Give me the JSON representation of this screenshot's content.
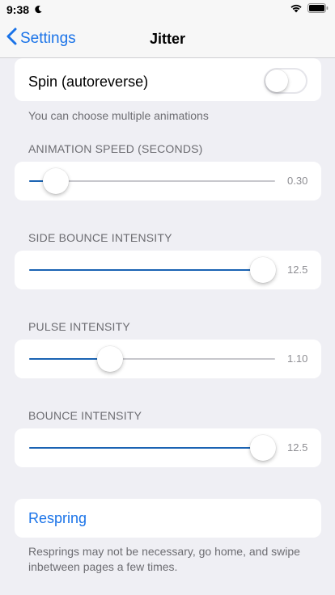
{
  "status": {
    "time": "9:38"
  },
  "nav": {
    "back_label": "Settings",
    "title": "Jitter"
  },
  "spin": {
    "label": "Spin (autoreverse)",
    "enabled": false,
    "footer": "You can choose multiple animations"
  },
  "sliders": [
    {
      "header": "ANIMATION SPEED (SECONDS)",
      "value_text": "0.30",
      "level": 0.11
    },
    {
      "header": "SIDE BOUNCE INTENSITY",
      "value_text": "12.5",
      "level": 0.95
    },
    {
      "header": "PULSE INTENSITY",
      "value_text": "1.10",
      "level": 0.33
    },
    {
      "header": "BOUNCE INTENSITY",
      "value_text": "12.5",
      "level": 0.95
    }
  ],
  "respring": {
    "label": "Respring",
    "footer": "Resprings may not be necessary, go home, and swipe inbetween pages a few times."
  },
  "colors": {
    "accent": "#1a73e8",
    "track_fill": "#1a63b3",
    "background": "#efeff4"
  }
}
